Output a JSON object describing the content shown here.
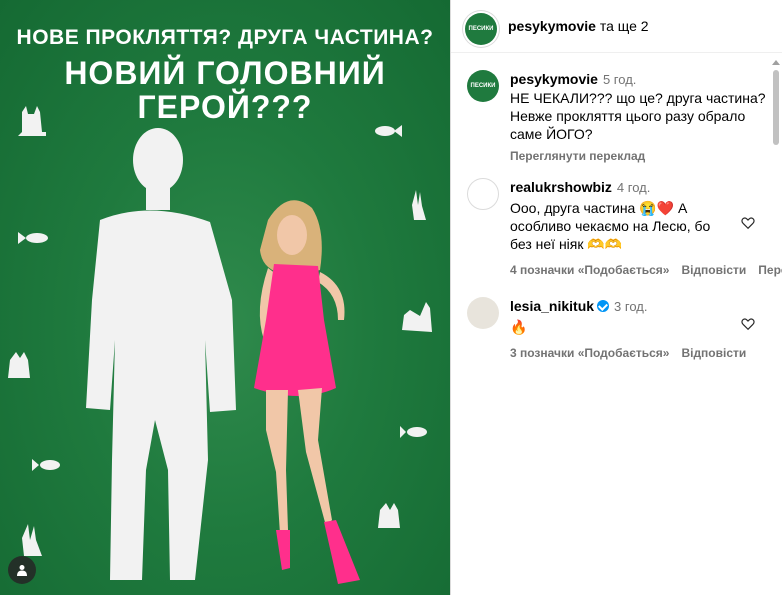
{
  "post_image": {
    "headline_line1": "НОВЕ ПРОКЛЯТТЯ? ДРУГА ЧАСТИНА?",
    "headline_line2": "НОВИЙ ГОЛОВНИЙ",
    "headline_line3": "ГЕРОЙ???",
    "background_color": "#1f7a3e",
    "dress_color": "#ff2f8c"
  },
  "header": {
    "username": "pesykymovie",
    "suffix": "та ще 2",
    "avatar_text": "ПЕСИКИ"
  },
  "caption": {
    "username": "pesykymovie",
    "time": "5 год.",
    "text": "НЕ ЧЕКАЛИ??? що це? друга частина? Невже прокляття цього разу обрало саме ЙОГО?",
    "translate": "Переглянути переклад"
  },
  "comments": [
    {
      "username": "realukrshowbiz",
      "time": "4 год.",
      "text": "Ооо, друга частина 😭❤️ А особливо чекаємо на Лесю, бо без неї ніяк 🫶🫶",
      "likes": "4 позначки «Подобається»",
      "reply": "Відповісти",
      "extra": "Пере"
    },
    {
      "username": "lesia_nikituk",
      "time": "3 год.",
      "text": "🔥",
      "likes": "3 позначки «Подобається»",
      "reply": "Відповісти"
    }
  ]
}
